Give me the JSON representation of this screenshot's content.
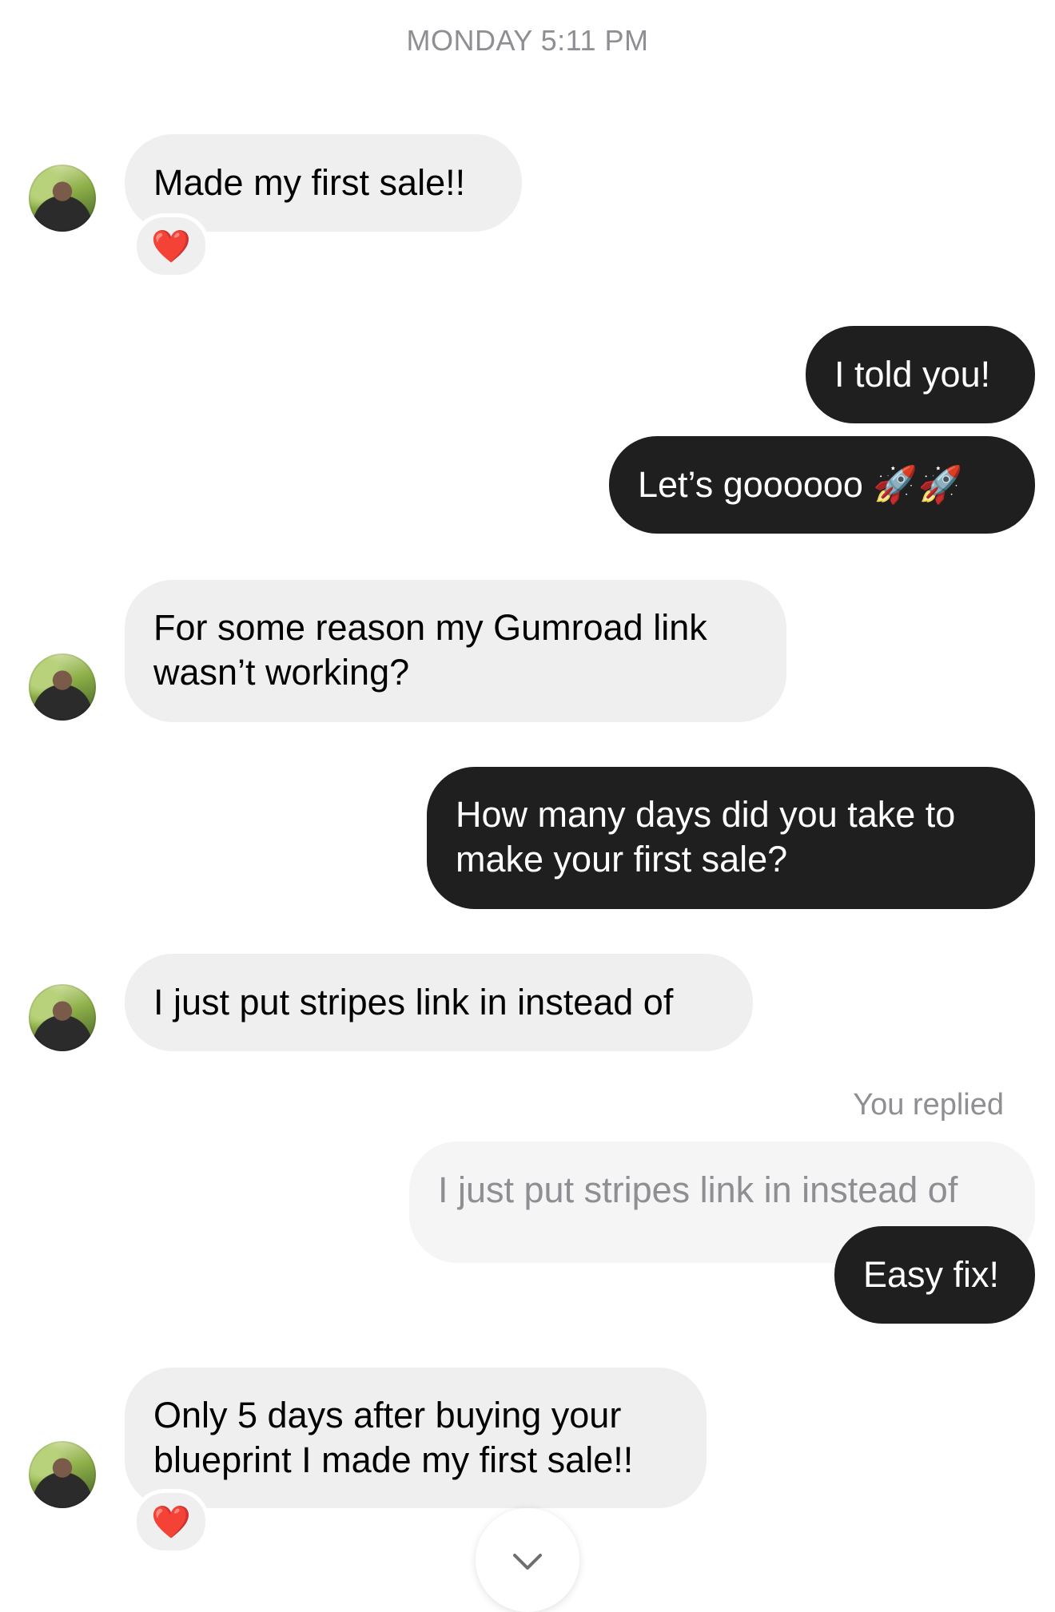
{
  "timestamp": "MONDAY 5:11 PM",
  "messages": [
    {
      "text": "Made my first sale!!",
      "reaction": "❤️"
    },
    {
      "text": "I told you!"
    },
    {
      "text": "Let’s goooooo 🚀🚀"
    },
    {
      "text": "For some reason my Gumroad link\nwasn’t working?"
    },
    {
      "text": "How many days did you take to\nmake your first sale?"
    },
    {
      "text": "I just put stripes link in instead of"
    },
    {
      "text": "I just put stripes link in instead of"
    },
    {
      "text": "Easy fix!"
    },
    {
      "text": "Only 5 days after buying your\nblueprint I made my first sale!!",
      "reaction": "❤️"
    }
  ],
  "reply_label": "You replied",
  "icons": {
    "heart": "heart-icon",
    "scroll": "chevron-down-icon",
    "avatar": "contact-avatar"
  },
  "colors": {
    "incoming_bubble": "#efefef",
    "outgoing_bubble": "#1f1f1f",
    "meta_text": "#8e8e93",
    "heart": "#e0242d"
  }
}
